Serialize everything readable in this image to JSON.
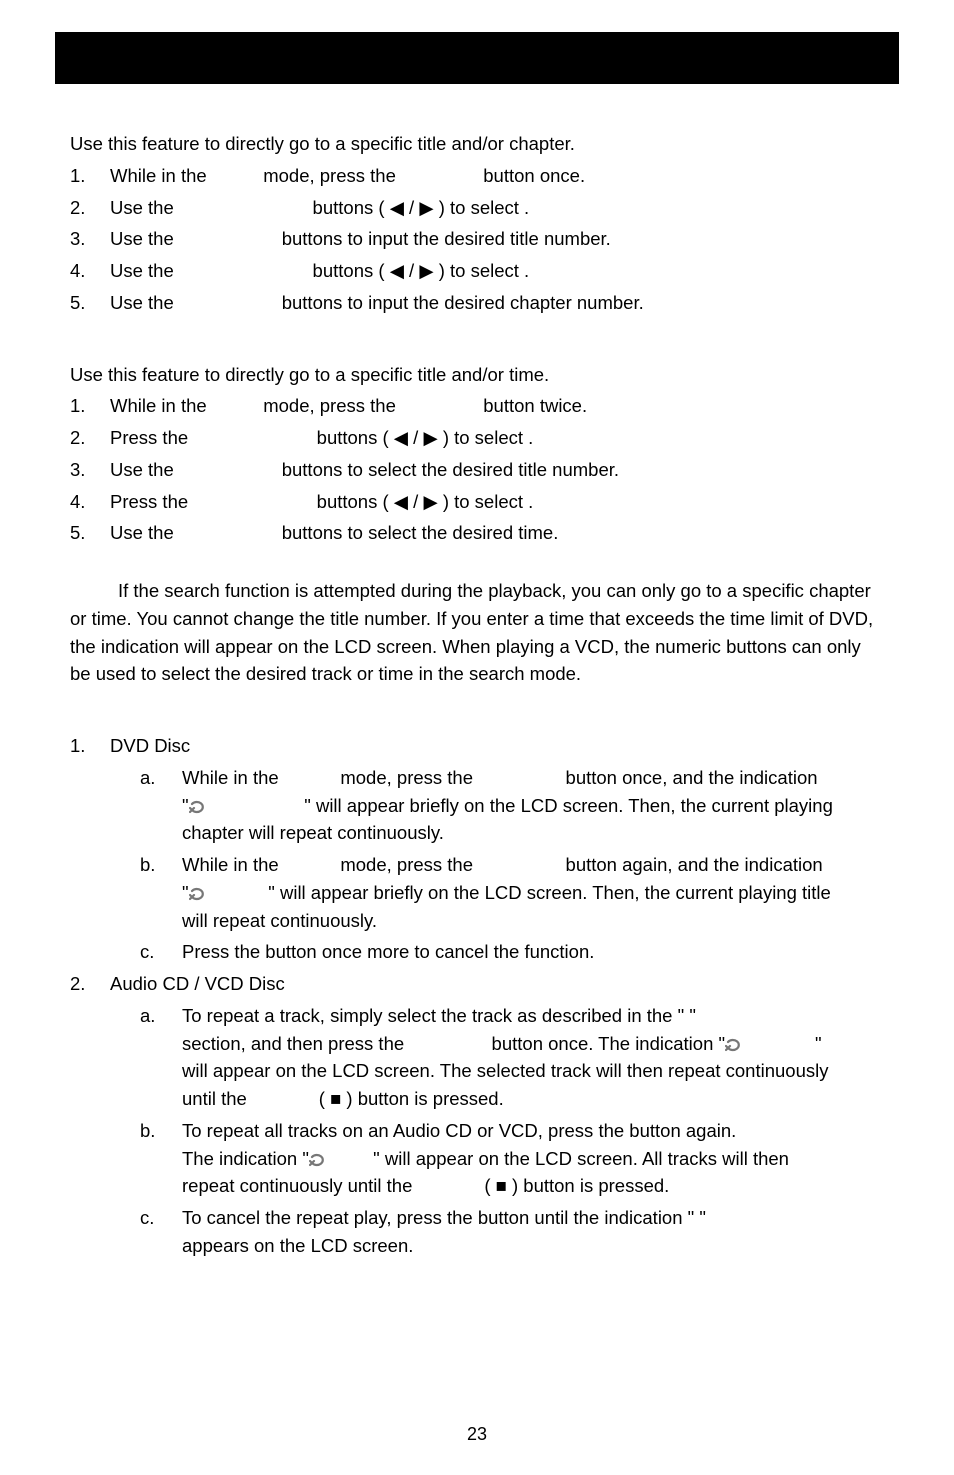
{
  "section1": {
    "intro": "Use this feature to directly go to a specific title and/or chapter.",
    "items": [
      {
        "n": "1.",
        "pre": "While in the ",
        "mid": " mode, press the ",
        "post": " button once."
      },
      {
        "n": "2.",
        "pre": "Use the ",
        "mid": " buttons (",
        "arrows": "◀ / ▶",
        "post": ") to select              ."
      },
      {
        "n": "3.",
        "pre": "Use the ",
        "full": " buttons to input the desired title number."
      },
      {
        "n": "4.",
        "pre": "Use the ",
        "mid": " buttons (",
        "arrows": "◀ / ▶",
        "post": ") to select                    ."
      },
      {
        "n": "5.",
        "pre": "Use the ",
        "full": " buttons to input the desired chapter number."
      }
    ]
  },
  "section2": {
    "intro": "Use this feature to directly go to a specific title and/or time.",
    "items": [
      {
        "n": "1.",
        "pre": "While in the ",
        "mid": " mode, press the ",
        "post": " button twice."
      },
      {
        "n": "2.",
        "pre": "Press the ",
        "mid": " buttons (",
        "arrows": "◀ / ▶",
        "post": ") to select              ."
      },
      {
        "n": "3.",
        "pre": "Use the ",
        "full": " buttons to select the desired title number."
      },
      {
        "n": "4.",
        "pre": "Press the ",
        "mid": " buttons (",
        "arrows": "◀ / ▶",
        "post": ") to select           ."
      },
      {
        "n": "5.",
        "pre": "Use the ",
        "full": " buttons to select the desired time."
      }
    ]
  },
  "note": "If the search function is attempted during the playback, you can only go to a specific chapter or time. You cannot change the title number. If you enter a time that exceeds the time limit of DVD, the indication                            will appear on the LCD screen. When playing a VCD, the numeric buttons can only be used to select the desired track or time in the search mode.",
  "section3": {
    "n1": "1.",
    "t1": "DVD Disc",
    "dvd": {
      "a": {
        "letter": "a.",
        "l1_pre": "While in the ",
        "l1_mid": " mode, press the ",
        "l1_post": " button once, and the indication",
        "l2_pre": "\"",
        "l2_post": "\" will appear briefly on the LCD screen. Then, the current playing",
        "l3": "chapter will repeat continuously."
      },
      "b": {
        "letter": "b.",
        "l1_pre": "While in the ",
        "l1_mid": " mode, press the ",
        "l1_post": " button again, and the indication",
        "l2_pre": "\"",
        "l2_post": "\" will appear briefly on the LCD screen. Then, the current playing title",
        "l3": "will repeat continuously."
      },
      "c": {
        "letter": "c.",
        "l1": "Press the                 button once more to cancel the                  function."
      }
    },
    "n2": "2.",
    "t2": "Audio CD / VCD Disc",
    "cd": {
      "a": {
        "letter": "a.",
        "l1": "To repeat a track, simply select the track as described in the \"                            \"",
        "l2_pre": "section, and then press the ",
        "l2_mid": " button once. The indication \"",
        "l2_post": "\"",
        "l3": "will appear on the LCD screen. The selected track will then repeat continuously",
        "l4_pre": "until the ",
        "l4_mid": " (",
        "l4_sq": "■",
        "l4_post": ") button is pressed."
      },
      "b": {
        "letter": "b.",
        "l1": "To repeat all tracks on an Audio CD or VCD, press the                   button again.",
        "l2_pre": "The indication \"",
        "l2_post": "\" will appear on the LCD screen. All tracks will then",
        "l3_pre": "repeat continuously until the ",
        "l3_mid": " (",
        "l3_sq": "■",
        "l3_post": ") button is pressed."
      },
      "c": {
        "letter": "c.",
        "l1": "To cancel the repeat play, press the                  button until the indication \"        \"",
        "l2": "appears on the LCD screen."
      }
    }
  },
  "pageNumber": "23"
}
